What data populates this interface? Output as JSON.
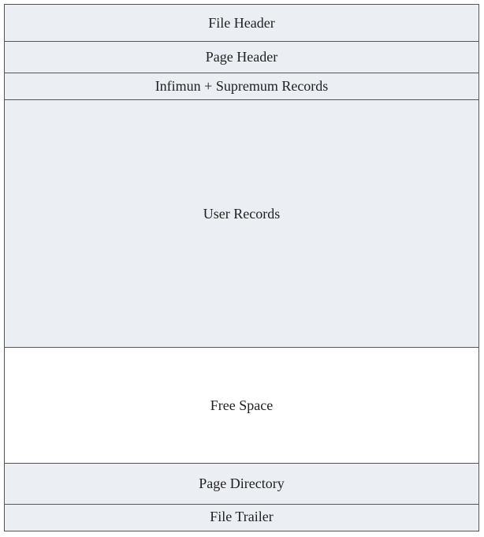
{
  "sections": [
    {
      "label": "File Header"
    },
    {
      "label": "Page Header"
    },
    {
      "label": "Infimun + Supremum Records"
    },
    {
      "label": "User Records"
    },
    {
      "label": "Free Space"
    },
    {
      "label": "Page Directory"
    },
    {
      "label": "File Trailer"
    }
  ],
  "colors": {
    "filled_section": "#ebeef3",
    "free_section": "#ffffff",
    "border": "#555555"
  }
}
